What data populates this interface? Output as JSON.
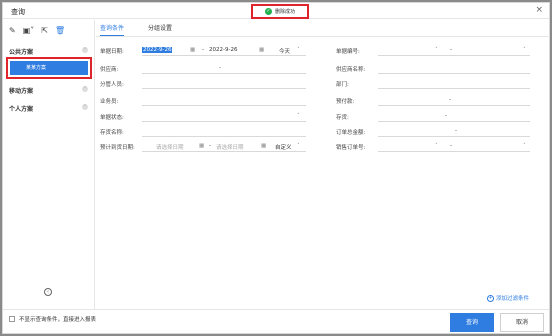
{
  "title": "查询",
  "toast": {
    "text": "删除成功"
  },
  "sidebar": {
    "groups": [
      {
        "label": "公共方案"
      },
      {
        "label": "移动方案"
      },
      {
        "label": "个人方案"
      }
    ],
    "selected_plan": "某某方案"
  },
  "tabs": [
    {
      "label": "查询条件"
    },
    {
      "label": "分组设置"
    }
  ],
  "form": {
    "doc_date_label": "单据日期:",
    "doc_date_from": "2022-9-26",
    "doc_date_sep": "-",
    "doc_date_to": "2022-9-26",
    "doc_date_preset": "今天",
    "doc_no_label": "单据编号:",
    "doc_no_sep": "-",
    "supplier_label": "供应商:",
    "supplier_sep": "-",
    "supplier_name_label": "供应商名称:",
    "manager_label": "分管人员:",
    "dept_label": "部门:",
    "salesman_label": "业务员:",
    "prepaid_label": "预付款:",
    "prepaid_sep": "-",
    "status_label": "单据状态:",
    "inventory_label": "存货:",
    "inventory_sep": "-",
    "inventory_name_label": "存货名称:",
    "order_amount_label": "订单总金额:",
    "order_amount_sep": "-",
    "arrival_label": "预计到货日期:",
    "arrival_from_ph": "请选择日期",
    "arrival_sep": "-",
    "arrival_to_ph": "请选择日期",
    "arrival_preset": "自定义",
    "sales_order_label": "销售订单号:",
    "sales_order_sep": "-"
  },
  "add_filter": "添加过滤条件",
  "footer": {
    "checkbox_label": "不显示查询条件，直接进入报表",
    "query_btn": "查询",
    "cancel_btn": "取消"
  }
}
